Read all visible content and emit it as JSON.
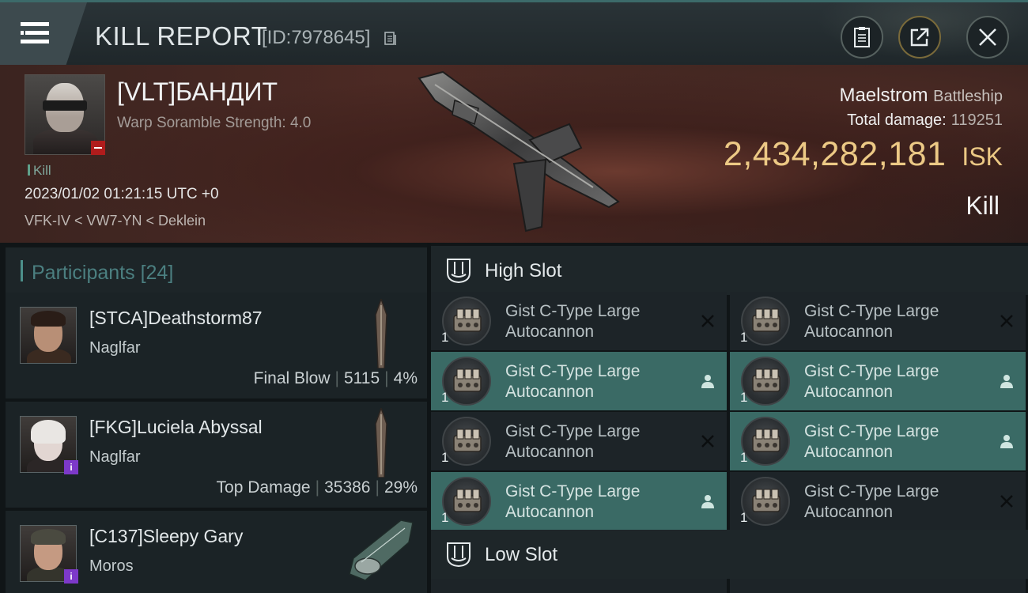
{
  "header": {
    "title": "KILL REPORT",
    "report_id": "[ID:7978645]",
    "icons": {
      "menu": "menu-icon",
      "copy": "copy-icon",
      "clipboard": "clipboard-icon",
      "share": "share-icon",
      "close": "close-icon"
    }
  },
  "victim": {
    "name": "[VLT]БАНДИТ",
    "scramble": "Warp Soramble Strength: 4.0",
    "kill_label": "Kill",
    "datetime": "2023/01/02 01:21:15 UTC +0",
    "location": "VFK-IV < VW7-YN < Deklein",
    "ship_name": "Maelstrom",
    "ship_class": "Battleship",
    "total_damage_label": "Total damage:",
    "total_damage": "119251",
    "isk_value": "2,434,282,181",
    "isk_unit": "ISK",
    "result": "Kill"
  },
  "participants": {
    "title": "Participants",
    "count": "[24]",
    "items": [
      {
        "name": "[STCA]Deathstorm87",
        "ship": "Naglfar",
        "role": "Final Blow",
        "damage": "5115",
        "percent": "4%",
        "badge": ""
      },
      {
        "name": "[FKG]Luciela Abyssal",
        "ship": "Naglfar",
        "role": "Top Damage",
        "damage": "35386",
        "percent": "29%",
        "badge": "i"
      },
      {
        "name": "[C137]Sleepy Gary",
        "ship": "Moros",
        "role": "",
        "damage": "",
        "percent": "",
        "badge": "i"
      }
    ]
  },
  "fitting": {
    "high_slot": {
      "title": "High Slot",
      "modules": [
        {
          "qty": "1",
          "name_line1": "Gist C-Type Large",
          "name_line2": "Autocannon",
          "status": "destroyed"
        },
        {
          "qty": "1",
          "name_line1": "Gist C-Type Large",
          "name_line2": "Autocannon",
          "status": "destroyed"
        },
        {
          "qty": "1",
          "name_line1": "Gist C-Type Large",
          "name_line2": "Autocannon",
          "status": "dropped"
        },
        {
          "qty": "1",
          "name_line1": "Gist C-Type Large",
          "name_line2": "Autocannon",
          "status": "dropped"
        },
        {
          "qty": "1",
          "name_line1": "Gist C-Type Large",
          "name_line2": "Autocannon",
          "status": "destroyed"
        },
        {
          "qty": "1",
          "name_line1": "Gist C-Type Large",
          "name_line2": "Autocannon",
          "status": "dropped"
        },
        {
          "qty": "1",
          "name_line1": "Gist C-Type Large",
          "name_line2": "Autocannon",
          "status": "dropped"
        },
        {
          "qty": "1",
          "name_line1": "Gist C-Type Large",
          "name_line2": "Autocannon",
          "status": "destroyed"
        }
      ]
    },
    "low_slot": {
      "title": "Low Slot"
    }
  },
  "colors": {
    "accent": "#4b7f80",
    "isk": "#ecc985",
    "fitted_row": "#3a6a65",
    "badge_purple": "#7d39c9",
    "badge_red": "#b01c1c"
  }
}
